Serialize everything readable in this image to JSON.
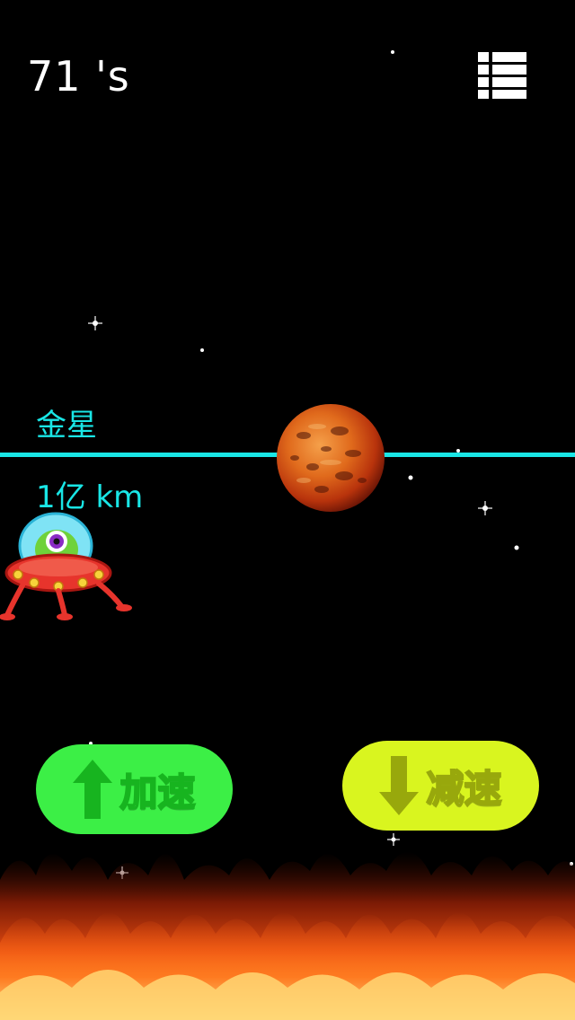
{
  "hud": {
    "timer_text": "71 's",
    "menu_icon": "list-menu-icon"
  },
  "planet": {
    "name": "金星",
    "distance": "1亿 km",
    "icon": "venus-planet-icon"
  },
  "player": {
    "icon": "ufo-alien-icon"
  },
  "controls": {
    "accelerate_label": "加速",
    "decelerate_label": "减速"
  },
  "colors": {
    "orbit_line": "#19e6e6",
    "accelerate_button": "#3cef46",
    "decelerate_button": "#d9f51f",
    "background": "#000000"
  }
}
